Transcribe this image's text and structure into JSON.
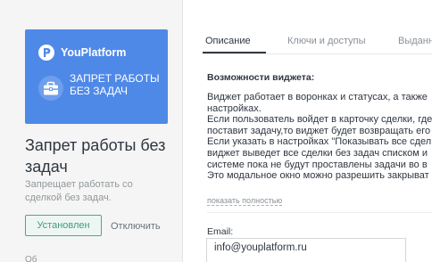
{
  "widget": {
    "brand_name": "YouPlatform",
    "banner_lines": [
      "ЗАПРЕТ РАБОТЫ",
      "БЕЗ ЗАДАЧ"
    ],
    "title_lines": [
      "Запрет работы без",
      "задач"
    ],
    "description_lines": [
      "Запрещает работать со",
      "сделкой без задач."
    ],
    "installed_label": "Установлен",
    "disable_label": "Отключить",
    "cut_text": "Об",
    "brand_color": "#4f89e8"
  },
  "tabs": [
    {
      "label": "Описание",
      "active": true
    },
    {
      "label": "Ключи и доступы",
      "active": false
    },
    {
      "label": "Выданн",
      "active": false
    }
  ],
  "description": {
    "section_title": "Возможности виджета:",
    "lines": [
      "Виджет работает в воронках и статусах, а также",
      "настройках.",
      "Если пользователь войдет в карточку сделки, где",
      "поставит задачу,то виджет будет возвращать его",
      "Если указать в настройках \"Показывать все сдел",
      "виджет выведет все сделки без задач списком и",
      "системе пока не будут проставлены задачи во в",
      "Это модальное окно можно разрешить закрыват"
    ],
    "show_more": "показать полностью"
  },
  "settings": {
    "email_label": "Email:",
    "email_value": "info@youplatform.ru"
  }
}
